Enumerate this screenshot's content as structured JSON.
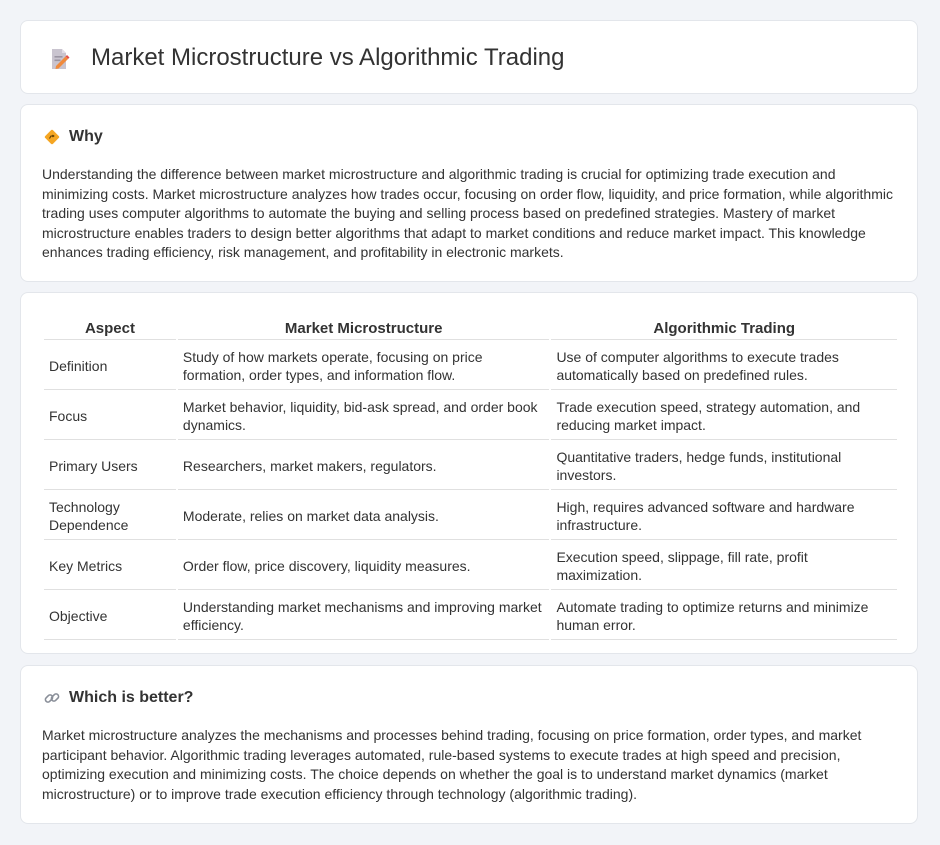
{
  "header": {
    "title": "Market Microstructure vs Algorithmic Trading",
    "icon": "document-edit-icon"
  },
  "why": {
    "icon": "diamond-sign-icon",
    "heading": "Why",
    "text": "Understanding the difference between market microstructure and algorithmic trading is crucial for optimizing trade execution and minimizing costs. Market microstructure analyzes how trades occur, focusing on order flow, liquidity, and price formation, while algorithmic trading uses computer algorithms to automate the buying and selling process based on predefined strategies. Mastery of market microstructure enables traders to design better algorithms that adapt to market conditions and reduce market impact. This knowledge enhances trading efficiency, risk management, and profitability in electronic markets."
  },
  "table": {
    "headers": [
      "Aspect",
      "Market Microstructure",
      "Algorithmic Trading"
    ],
    "rows": [
      {
        "aspect": "Definition",
        "micro": "Study of how markets operate, focusing on price formation, order types, and information flow.",
        "algo": "Use of computer algorithms to execute trades automatically based on predefined rules."
      },
      {
        "aspect": "Focus",
        "micro": "Market behavior, liquidity, bid-ask spread, and order book dynamics.",
        "algo": "Trade execution speed, strategy automation, and reducing market impact."
      },
      {
        "aspect": "Primary Users",
        "micro": "Researchers, market makers, regulators.",
        "algo": "Quantitative traders, hedge funds, institutional investors."
      },
      {
        "aspect": "Technology Dependence",
        "micro": "Moderate, relies on market data analysis.",
        "algo": "High, requires advanced software and hardware infrastructure."
      },
      {
        "aspect": "Key Metrics",
        "micro": "Order flow, price discovery, liquidity measures.",
        "algo": "Execution speed, slippage, fill rate, profit maximization."
      },
      {
        "aspect": "Objective",
        "micro": "Understanding market mechanisms and improving market efficiency.",
        "algo": "Automate trading to optimize returns and minimize human error."
      }
    ]
  },
  "better": {
    "icon": "link-icon",
    "heading": "Which is better?",
    "text": "Market microstructure analyzes the mechanisms and processes behind trading, focusing on price formation, order types, and market participant behavior. Algorithmic trading leverages automated, rule-based systems to execute trades at high speed and precision, optimizing execution and minimizing costs. The choice depends on whether the goal is to understand market dynamics (market microstructure) or to improve trade execution efficiency through technology (algorithmic trading)."
  }
}
